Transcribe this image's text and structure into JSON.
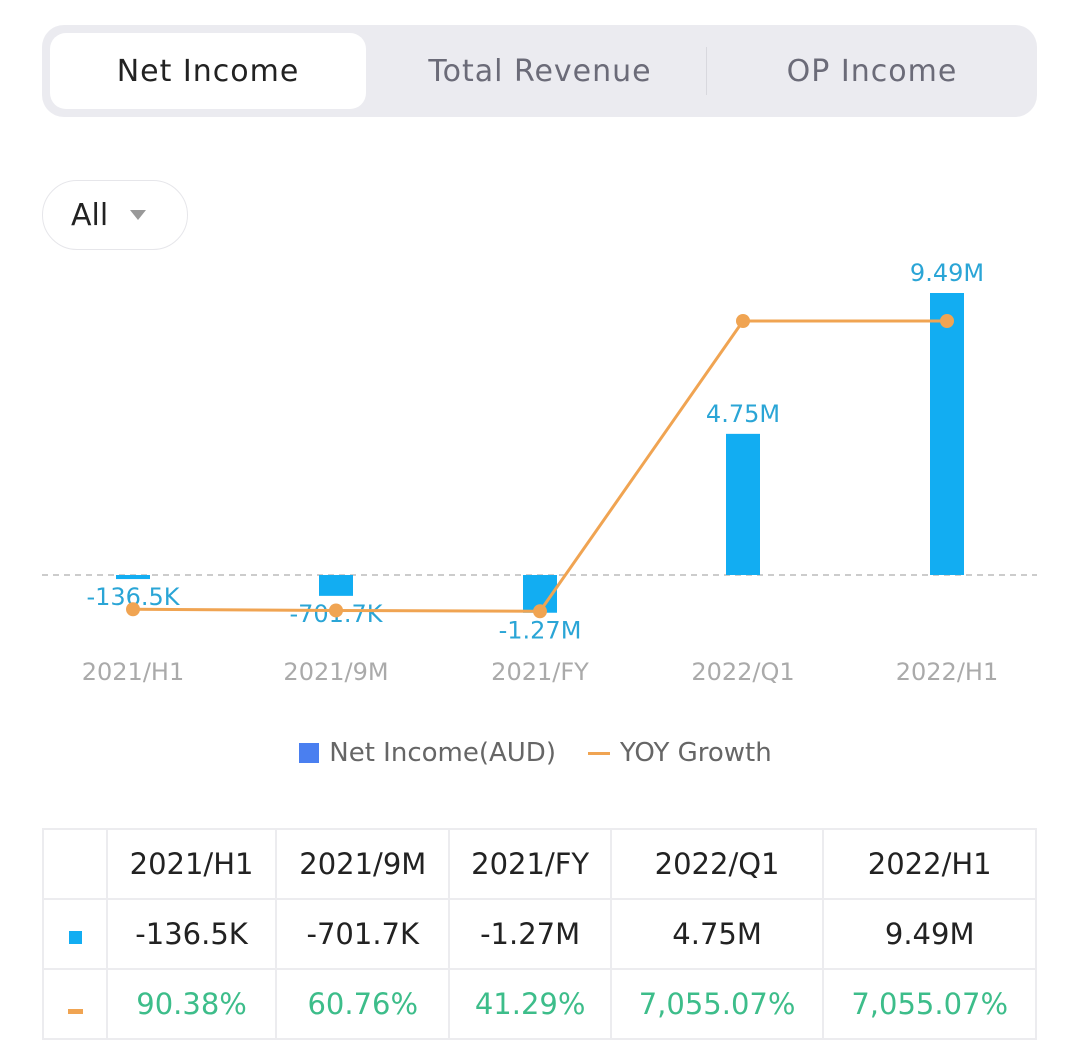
{
  "tabs": [
    {
      "label": "Net Income",
      "active": true
    },
    {
      "label": "Total Revenue",
      "active": false
    },
    {
      "label": "OP Income",
      "active": false
    }
  ],
  "filter": {
    "selected": "All"
  },
  "chart_data": {
    "type": "bar",
    "categories": [
      "2021/H1",
      "2021/9M",
      "2021/FY",
      "2022/Q1",
      "2022/H1"
    ],
    "series": [
      {
        "name": "Net Income(AUD)",
        "type": "bar",
        "values": [
          -136500,
          -701700,
          -1270000,
          4750000,
          9490000
        ],
        "labels": [
          "-136.5K",
          "-701.7K",
          "-1.27M",
          "4.75M",
          "9.49M"
        ],
        "color": "#12adf2"
      },
      {
        "name": "YOY Growth",
        "type": "line",
        "values": [
          90.38,
          60.76,
          41.29,
          7055.07,
          7055.07
        ],
        "labels": [
          "90.38%",
          "60.76%",
          "41.29%",
          "7,055.07%",
          "7,055.07%"
        ],
        "color": "#f0a452"
      }
    ],
    "legend_position": "bottom",
    "legend_square_color": "#4a7ff0"
  },
  "legend": {
    "bar": "Net Income(AUD)",
    "line": "YOY Growth"
  }
}
